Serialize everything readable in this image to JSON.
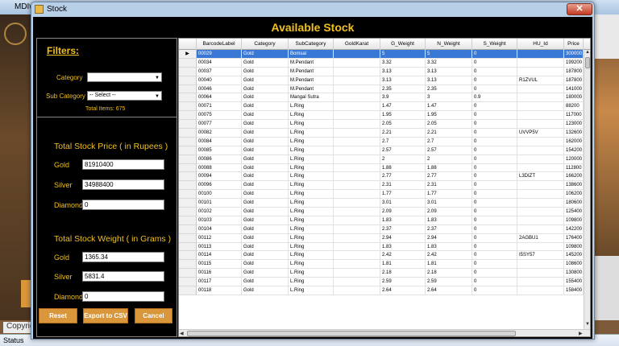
{
  "mdi": {
    "title": "MDIwin",
    "copyright": "Copyright",
    "status": "Status"
  },
  "window": {
    "title": "Stock",
    "close_label": "✕"
  },
  "header": {
    "title": "Available Stock"
  },
  "filters": {
    "title": "Filters:",
    "category_label": "Category",
    "category_value": "",
    "subcategory_label": "Sub Category",
    "subcategory_value": "-- Select --",
    "total_items": "Total Items: 675"
  },
  "price_section": {
    "title": "Total Stock Price ( in Rupees )",
    "gold_label": "Gold",
    "gold_value": "81910400",
    "silver_label": "Silver",
    "silver_value": "34988400",
    "diamond_label": "Diamond",
    "diamond_value": "0"
  },
  "weight_section": {
    "title": "Total Stock Weight ( in Grams )",
    "gold_label": "Gold",
    "gold_value": "1365.34",
    "silver_label": "Silver",
    "silver_value": "5831.4",
    "diamond_label": "Diamond",
    "diamond_value": "0"
  },
  "buttons": {
    "reset": "Reset",
    "export": "Export to CSV",
    "cancel": "Cancel"
  },
  "grid": {
    "columns": [
      "BarcodeLabel",
      "Category",
      "SubCategory",
      "GoldKarat",
      "G_Weight",
      "N_Weight",
      "S_Weight",
      "HU_Id",
      "Price"
    ],
    "selected_row": 0,
    "rows": [
      [
        "00029",
        "Gold",
        "Bomsal",
        "",
        "5",
        "5",
        "0",
        "",
        "300000"
      ],
      [
        "00034",
        "Gold",
        "M.Pendant",
        "",
        "3.32",
        "3.32",
        "0",
        "",
        "199200"
      ],
      [
        "00037",
        "Gold",
        "M.Pendant",
        "",
        "3.13",
        "3.13",
        "0",
        "",
        "187800"
      ],
      [
        "00040",
        "Gold",
        "M.Pendant",
        "",
        "3.13",
        "3.13",
        "0",
        "R1ZVUL",
        "187800"
      ],
      [
        "00046",
        "Gold",
        "M.Pendant",
        "",
        "2.35",
        "2.35",
        "0",
        "",
        "141000"
      ],
      [
        "00064",
        "Gold",
        "Mangal Sutra",
        "",
        "3.9",
        "3",
        "0.9",
        "",
        "180000"
      ],
      [
        "00071",
        "Gold",
        "L.Ring",
        "",
        "1.47",
        "1.47",
        "0",
        "",
        "88200"
      ],
      [
        "00075",
        "Gold",
        "L.Ring",
        "",
        "1.95",
        "1.95",
        "0",
        "",
        "117000"
      ],
      [
        "00077",
        "Gold",
        "L.Ring",
        "",
        "2.05",
        "2.05",
        "0",
        "",
        "123000"
      ],
      [
        "00082",
        "Gold",
        "L.Ring",
        "",
        "2.21",
        "2.21",
        "0",
        "UVVP5V",
        "132600"
      ],
      [
        "00084",
        "Gold",
        "L.Ring",
        "",
        "2.7",
        "2.7",
        "0",
        "",
        "162000"
      ],
      [
        "00085",
        "Gold",
        "L.Ring",
        "",
        "2.57",
        "2.57",
        "0",
        "",
        "154200"
      ],
      [
        "00086",
        "Gold",
        "L.Ring",
        "",
        "2",
        "2",
        "0",
        "",
        "120000"
      ],
      [
        "00088",
        "Gold",
        "L.Ring",
        "",
        "1.88",
        "1.88",
        "0",
        "",
        "112800"
      ],
      [
        "00094",
        "Gold",
        "L.Ring",
        "",
        "2.77",
        "2.77",
        "0",
        "L3DIZT",
        "166200"
      ],
      [
        "00096",
        "Gold",
        "L.Ring",
        "",
        "2.31",
        "2.31",
        "0",
        "",
        "138600"
      ],
      [
        "00100",
        "Gold",
        "L.Ring",
        "",
        "1.77",
        "1.77",
        "0",
        "",
        "106200"
      ],
      [
        "00101",
        "Gold",
        "L.Ring",
        "",
        "3.01",
        "3.01",
        "0",
        "",
        "180600"
      ],
      [
        "00102",
        "Gold",
        "L.Ring",
        "",
        "2.09",
        "2.09",
        "0",
        "",
        "125400"
      ],
      [
        "00103",
        "Gold",
        "L.Ring",
        "",
        "1.83",
        "1.83",
        "0",
        "",
        "109800"
      ],
      [
        "00104",
        "Gold",
        "L.Ring",
        "",
        "2.37",
        "2.37",
        "0",
        "",
        "142200"
      ],
      [
        "00112",
        "Gold",
        "L.Ring",
        "",
        "2.94",
        "2.94",
        "0",
        "2AGBU1",
        "176400"
      ],
      [
        "00113",
        "Gold",
        "L.Ring",
        "",
        "1.83",
        "1.83",
        "0",
        "",
        "109800"
      ],
      [
        "00114",
        "Gold",
        "L.Ring",
        "",
        "2.42",
        "2.42",
        "0",
        "I5SY57",
        "145200"
      ],
      [
        "00115",
        "Gold",
        "L.Ring",
        "",
        "1.81",
        "1.81",
        "0",
        "",
        "108600"
      ],
      [
        "00116",
        "Gold",
        "L.Ring",
        "",
        "2.18",
        "2.18",
        "0",
        "",
        "130800"
      ],
      [
        "00117",
        "Gold",
        "L.Ring",
        "",
        "2.59",
        "2.59",
        "0",
        "",
        "155400"
      ],
      [
        "00118",
        "Gold",
        "L.Ring",
        "",
        "2.64",
        "2.64",
        "0",
        "",
        "158400"
      ]
    ]
  },
  "colors": {
    "accent_gold": "#f0c020",
    "button_orange": "#d9963a",
    "selection_blue": "#3a78d6"
  }
}
